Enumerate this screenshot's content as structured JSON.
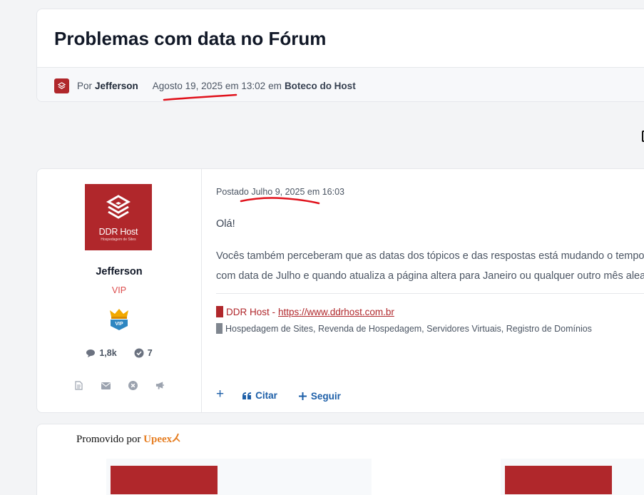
{
  "topic": {
    "title": "Problemas com data no Fórum",
    "by_label": "Por",
    "author": "Jefferson",
    "date": "Agosto 19, 2025 em 13:02",
    "em_label": "em",
    "forum": "Boteco do Host"
  },
  "author_panel": {
    "brand_name": "DDR Host",
    "brand_tagline": "Hospedagem de Sites",
    "name": "Jefferson",
    "rank": "VIP",
    "badge_text": "VIP",
    "posts_count": "1,8k",
    "reputation": "7",
    "action_icons": [
      "document-icon",
      "envelope-icon",
      "close-circle-icon",
      "megaphone-icon"
    ]
  },
  "post": {
    "date_line": "Postado Julho 9, 2025 em 16:03",
    "greeting": "Olá!",
    "body_line1": "Vocês também perceberam que as datas dos tópicos e das respostas está mudando o tempo todo? Você cria",
    "body_line2": "com data de Julho e quando atualiza a página altera para Janeiro ou qualquer outro mês aleatório.",
    "signature_brand": "DDR Host -",
    "signature_link": "https://www.ddrhost.com.br",
    "signature_services": "Hospedagem de Sites, Revenda de Hospedagem, Servidores Virtuais, Registro de Domínios",
    "actions": {
      "multiquote": "+",
      "quote_label": "Citar",
      "follow_label": "Seguir"
    }
  },
  "promo": {
    "label": "Promovido por",
    "brand": "Upeex"
  },
  "colors": {
    "brand_red": "#b0272b",
    "link_blue": "#1d5fa8",
    "annotation_red": "#e0121c"
  }
}
